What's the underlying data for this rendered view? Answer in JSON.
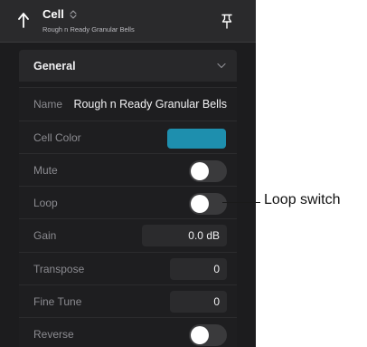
{
  "header": {
    "title": "Cell",
    "subtitle": "Rough n Ready Granular Bells"
  },
  "section": {
    "title": "General"
  },
  "rows": {
    "name": {
      "label": "Name",
      "value": "Rough n Ready Granular Bells"
    },
    "cell_color": {
      "label": "Cell Color",
      "color": "#1e8fae"
    },
    "mute": {
      "label": "Mute",
      "on": false
    },
    "loop": {
      "label": "Loop",
      "on": false
    },
    "gain": {
      "label": "Gain",
      "value": "0.0 dB"
    },
    "transpose": {
      "label": "Transpose",
      "value": "0"
    },
    "fine_tune": {
      "label": "Fine Tune",
      "value": "0"
    },
    "reverse": {
      "label": "Reverse",
      "on": false
    }
  },
  "callout": {
    "label": "Loop switch"
  },
  "icons": {
    "back": "back-arrow-icon",
    "title_chevron": "up-down-chevron-icon",
    "pin": "pin-icon",
    "section_chevron": "chevron-down-icon"
  }
}
